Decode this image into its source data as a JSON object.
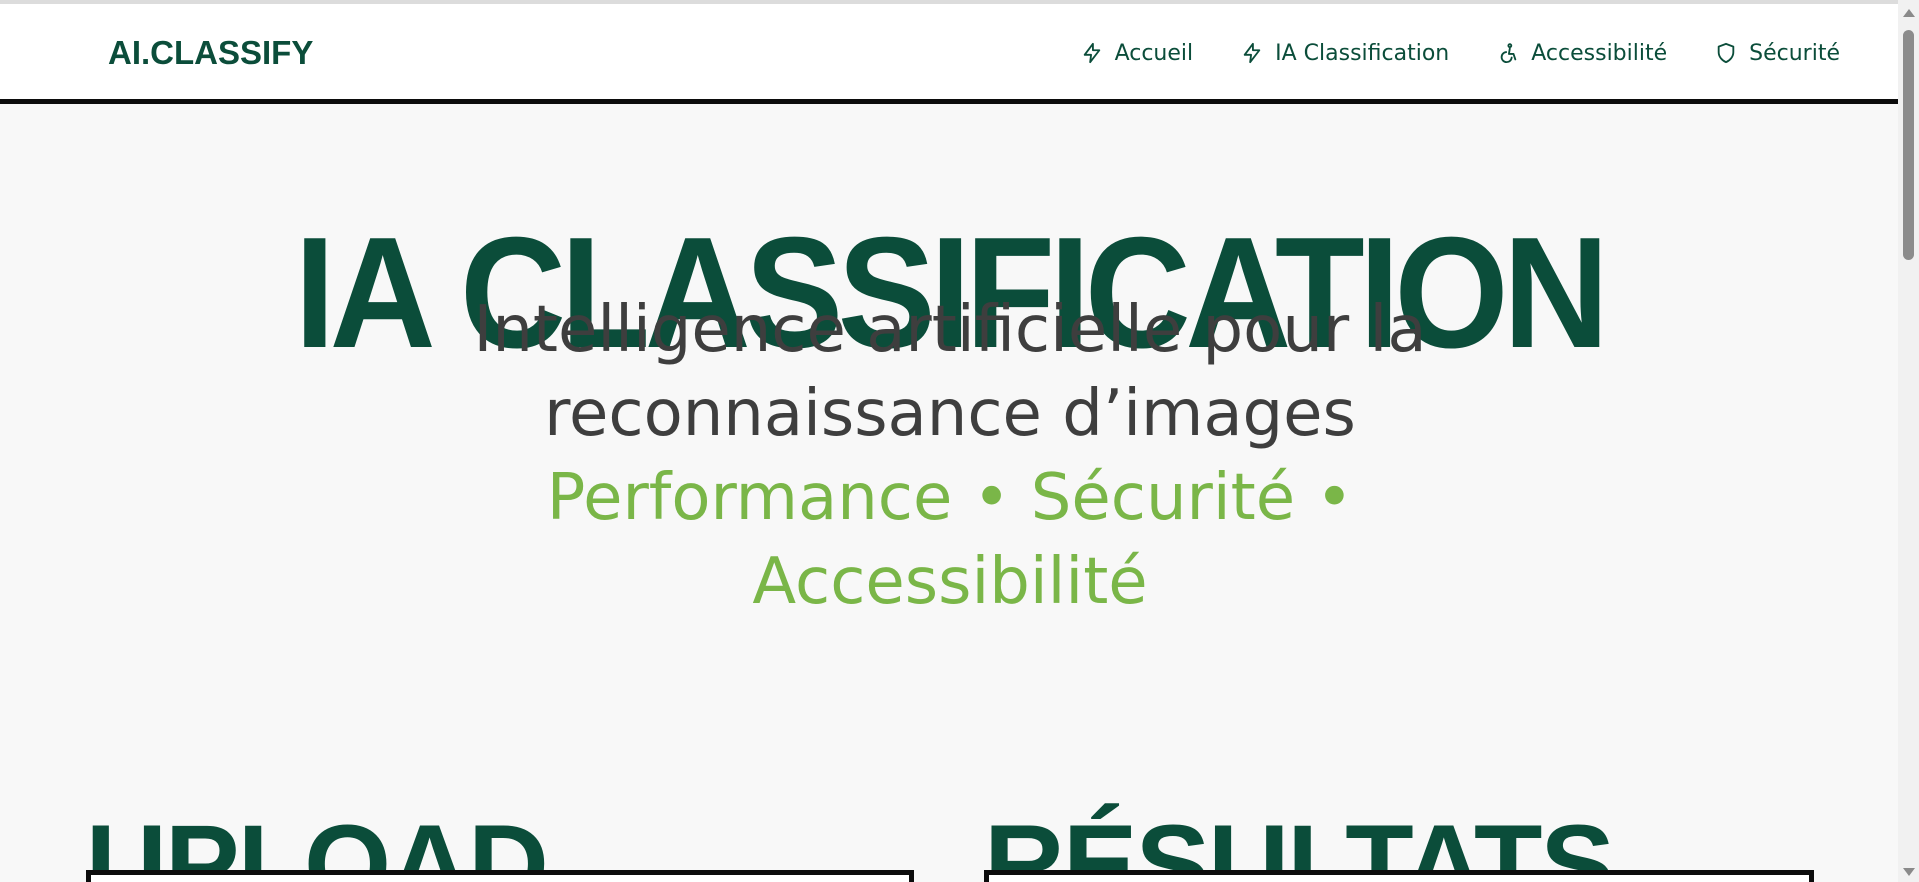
{
  "header": {
    "brand": "AI.CLASSIFY",
    "nav": [
      {
        "label": "Accueil",
        "icon": "bolt-icon"
      },
      {
        "label": "IA Classification",
        "icon": "bolt-icon"
      },
      {
        "label": "Accessibilité",
        "icon": "wheelchair-icon"
      },
      {
        "label": "Sécurité",
        "icon": "shield-icon"
      }
    ]
  },
  "hero": {
    "title": "IA CLASSIFICATION",
    "subtitle": "Intelligence artificielle pour la reconnaissance d’images",
    "tagline": "Performance • Sécurité • Accessibilité"
  },
  "sections": {
    "upload_title": "UPLOAD",
    "results_title": "RÉSULTATS"
  },
  "colors": {
    "brand": "#0b4d3a",
    "accent": "#7ab648",
    "text": "#3e3e3e",
    "background": "#f8f8f8"
  }
}
